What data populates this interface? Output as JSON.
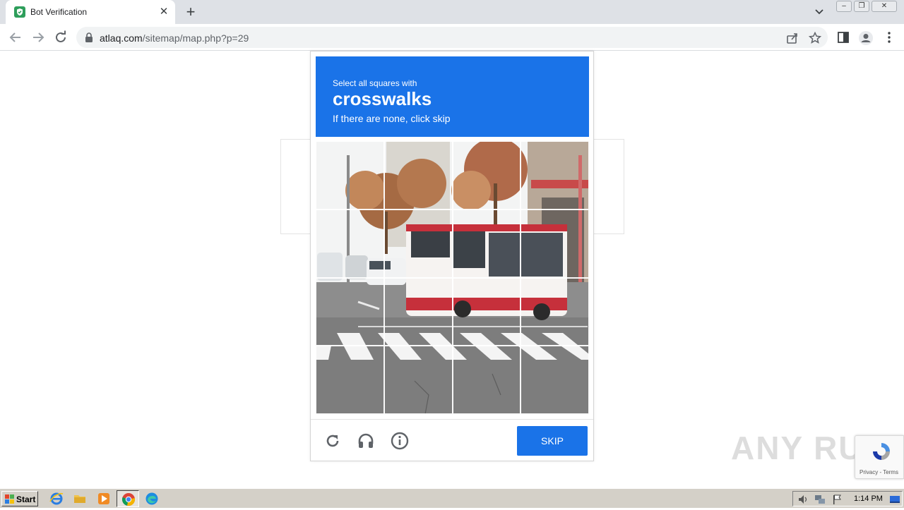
{
  "browser": {
    "tab_title": "Bot Verification",
    "tab_close": "✕",
    "new_tab": "+",
    "url_host": "atlaq.com",
    "url_path": "/sitemap/map.php?p=29"
  },
  "captcha": {
    "instruction_line1": "Select all squares with",
    "target_object": "crosswalks",
    "instruction_line3": "If there are none, click skip",
    "grid": {
      "rows": 4,
      "cols": 4
    },
    "skip_label": "SKIP",
    "accent_color": "#1a73e8"
  },
  "watermark": "ANY RUN",
  "recaptcha_badge": {
    "terms": "Privacy - Terms"
  },
  "taskbar": {
    "start_label": "Start",
    "clock": "1:14 PM"
  }
}
